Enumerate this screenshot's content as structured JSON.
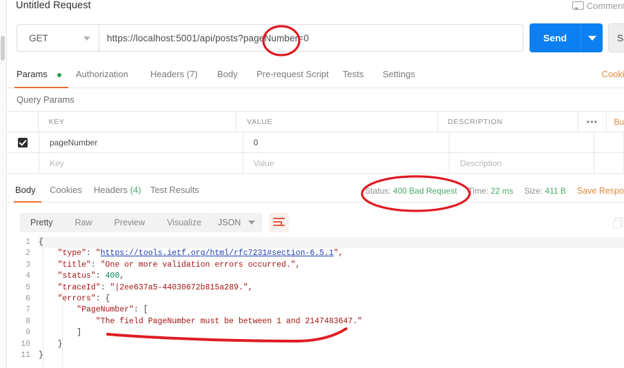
{
  "window": {
    "request_title": "Untitled Request",
    "comment_label": "Comment",
    "comment_icon": "comment-icon"
  },
  "url_bar": {
    "method": "GET",
    "method_caret_icon": "chevron-down-icon",
    "url": "https://localhost:5001/api/posts?pageNumber=0",
    "send_label": "Send",
    "send_caret_icon": "chevron-down-icon",
    "save_label": "Save"
  },
  "request_tabs": {
    "items": [
      {
        "label": "Params",
        "active": true,
        "dot": true
      },
      {
        "label": "Authorization",
        "active": false,
        "dot": false
      },
      {
        "label": "Headers (7)",
        "active": false,
        "dot": false
      },
      {
        "label": "Body",
        "active": false,
        "dot": false
      },
      {
        "label": "Pre-request Script",
        "active": false,
        "dot": false
      },
      {
        "label": "Tests",
        "active": false,
        "dot": false
      },
      {
        "label": "Settings",
        "active": false,
        "dot": false
      }
    ],
    "cookies_link": "Cookie"
  },
  "query_params": {
    "section_label": "Query Params",
    "columns": [
      "KEY",
      "VALUE",
      "DESCRIPTION"
    ],
    "more_icon": "ellipsis-icon",
    "bulk_edit_label": "Bu",
    "rows": [
      {
        "checked": true,
        "key": "pageNumber",
        "value": "0",
        "description": ""
      }
    ],
    "placeholder_row": {
      "key": "Key",
      "value": "Value",
      "description": "Description"
    }
  },
  "response": {
    "tabs": [
      {
        "label": "Body",
        "count": "",
        "active": true
      },
      {
        "label": "Cookies",
        "count": "",
        "active": false
      },
      {
        "label": "Headers",
        "count": "(4)",
        "active": false
      },
      {
        "label": "Test Results",
        "count": "",
        "active": false
      }
    ],
    "status_label": "Status:",
    "status_value": "400 Bad Request",
    "time_label": "Time:",
    "time_value": "22 ms",
    "size_label": "Size:",
    "size_value": "411 B",
    "save_response_label": "Save Respo",
    "format_tabs": [
      {
        "label": "Pretty",
        "active": true
      },
      {
        "label": "Raw",
        "active": false
      },
      {
        "label": "Preview",
        "active": false
      },
      {
        "label": "Visualize",
        "active": false
      }
    ],
    "language": "JSON",
    "language_caret_icon": "chevron-down-icon",
    "wrap_icon": "word-wrap-icon",
    "copy_icon": "copy-icon"
  },
  "code": {
    "line_numbers": [
      "1",
      "2",
      "3",
      "4",
      "5",
      "6",
      "7",
      "8",
      "9",
      "10",
      "11"
    ],
    "lines": [
      {
        "n": "1",
        "indent": 0,
        "segments": [
          {
            "t": "{",
            "c": "p"
          }
        ]
      },
      {
        "n": "2",
        "indent": 1,
        "segments": [
          {
            "t": "\"type\"",
            "c": "k"
          },
          {
            "t": ": ",
            "c": "p"
          },
          {
            "t": "\"",
            "c": "s"
          },
          {
            "t": "https://tools.ietf.org/html/rfc7231#section-6.5.1",
            "c": "lnk"
          },
          {
            "t": "\",",
            "c": "s"
          }
        ]
      },
      {
        "n": "3",
        "indent": 1,
        "segments": [
          {
            "t": "\"title\"",
            "c": "k"
          },
          {
            "t": ": ",
            "c": "p"
          },
          {
            "t": "\"One or more validation errors occurred.\",",
            "c": "s"
          }
        ]
      },
      {
        "n": "4",
        "indent": 1,
        "segments": [
          {
            "t": "\"status\"",
            "c": "k"
          },
          {
            "t": ": ",
            "c": "p"
          },
          {
            "t": "400",
            "c": "num"
          },
          {
            "t": ",",
            "c": "p"
          }
        ]
      },
      {
        "n": "5",
        "indent": 1,
        "segments": [
          {
            "t": "\"traceId\"",
            "c": "k"
          },
          {
            "t": ": ",
            "c": "p"
          },
          {
            "t": "\"|2ee637a5-44030672b815a289.\",",
            "c": "s"
          }
        ]
      },
      {
        "n": "6",
        "indent": 1,
        "segments": [
          {
            "t": "\"errors\"",
            "c": "k"
          },
          {
            "t": ": {",
            "c": "p"
          }
        ]
      },
      {
        "n": "7",
        "indent": 2,
        "segments": [
          {
            "t": "\"PageNumber\"",
            "c": "k"
          },
          {
            "t": ": [",
            "c": "p"
          }
        ]
      },
      {
        "n": "8",
        "indent": 3,
        "segments": [
          {
            "t": "\"The field PageNumber must be between 1 and 2147483647.\"",
            "c": "s"
          }
        ]
      },
      {
        "n": "9",
        "indent": 2,
        "segments": [
          {
            "t": "]",
            "c": "p"
          }
        ]
      },
      {
        "n": "10",
        "indent": 1,
        "segments": [
          {
            "t": "}",
            "c": "p"
          }
        ]
      },
      {
        "n": "11",
        "indent": 0,
        "segments": [
          {
            "t": "}",
            "c": "p"
          }
        ]
      }
    ]
  },
  "annotations": {
    "color": "#e01b22",
    "circle_url_note": "red ellipse around pageNumber=0 in url",
    "circle_status_note": "red ellipse around Status: 400 Bad Request",
    "underline_note": "red hand-drawn underline under validation message"
  }
}
